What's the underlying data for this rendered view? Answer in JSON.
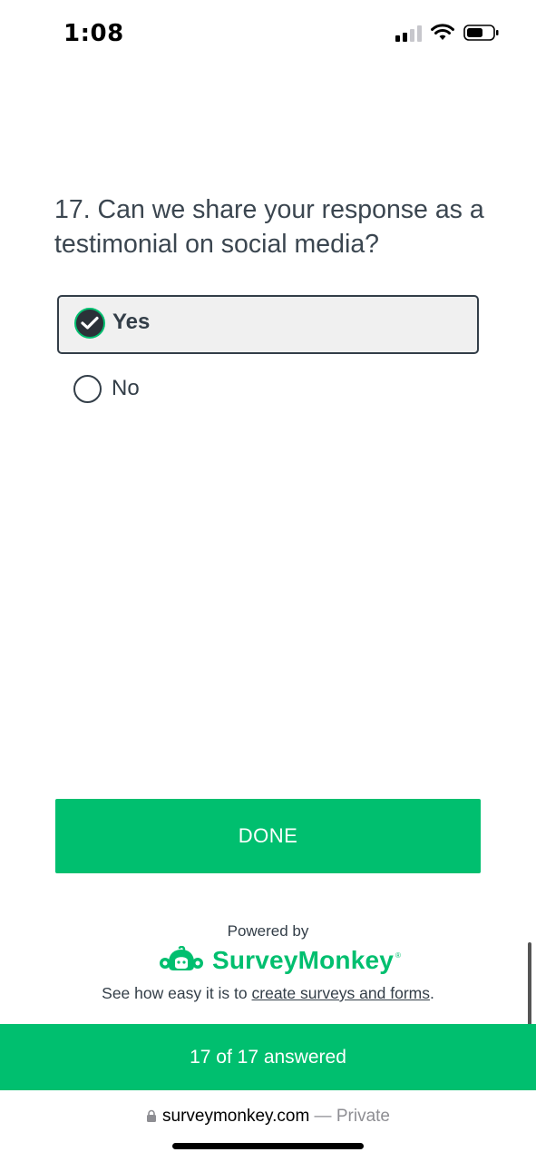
{
  "status_bar": {
    "time": "1:08"
  },
  "question": {
    "text": "17. Can we share your response as a testimonial on social media?",
    "options": [
      {
        "label": "Yes",
        "selected": true
      },
      {
        "label": "No",
        "selected": false
      }
    ]
  },
  "actions": {
    "done_label": "DONE"
  },
  "footer": {
    "powered_by": "Powered by",
    "brand_name": "SurveyMonkey",
    "brand_tm": "®",
    "see_how_prefix": "See how easy it is to ",
    "see_how_link": "create surveys and forms",
    "see_how_suffix": "."
  },
  "progress": {
    "text": "17 of 17 answered",
    "answered": 17,
    "total": 17
  },
  "browser": {
    "domain": "surveymonkey.com",
    "separator": " — ",
    "privacy": "Private"
  },
  "colors": {
    "accent": "#00bf6f",
    "text": "#333e48"
  },
  "icons": [
    "signal-icon",
    "wifi-icon",
    "battery-icon",
    "checkmark-icon",
    "radio-icon",
    "surveymonkey-logo-icon",
    "lock-icon"
  ]
}
